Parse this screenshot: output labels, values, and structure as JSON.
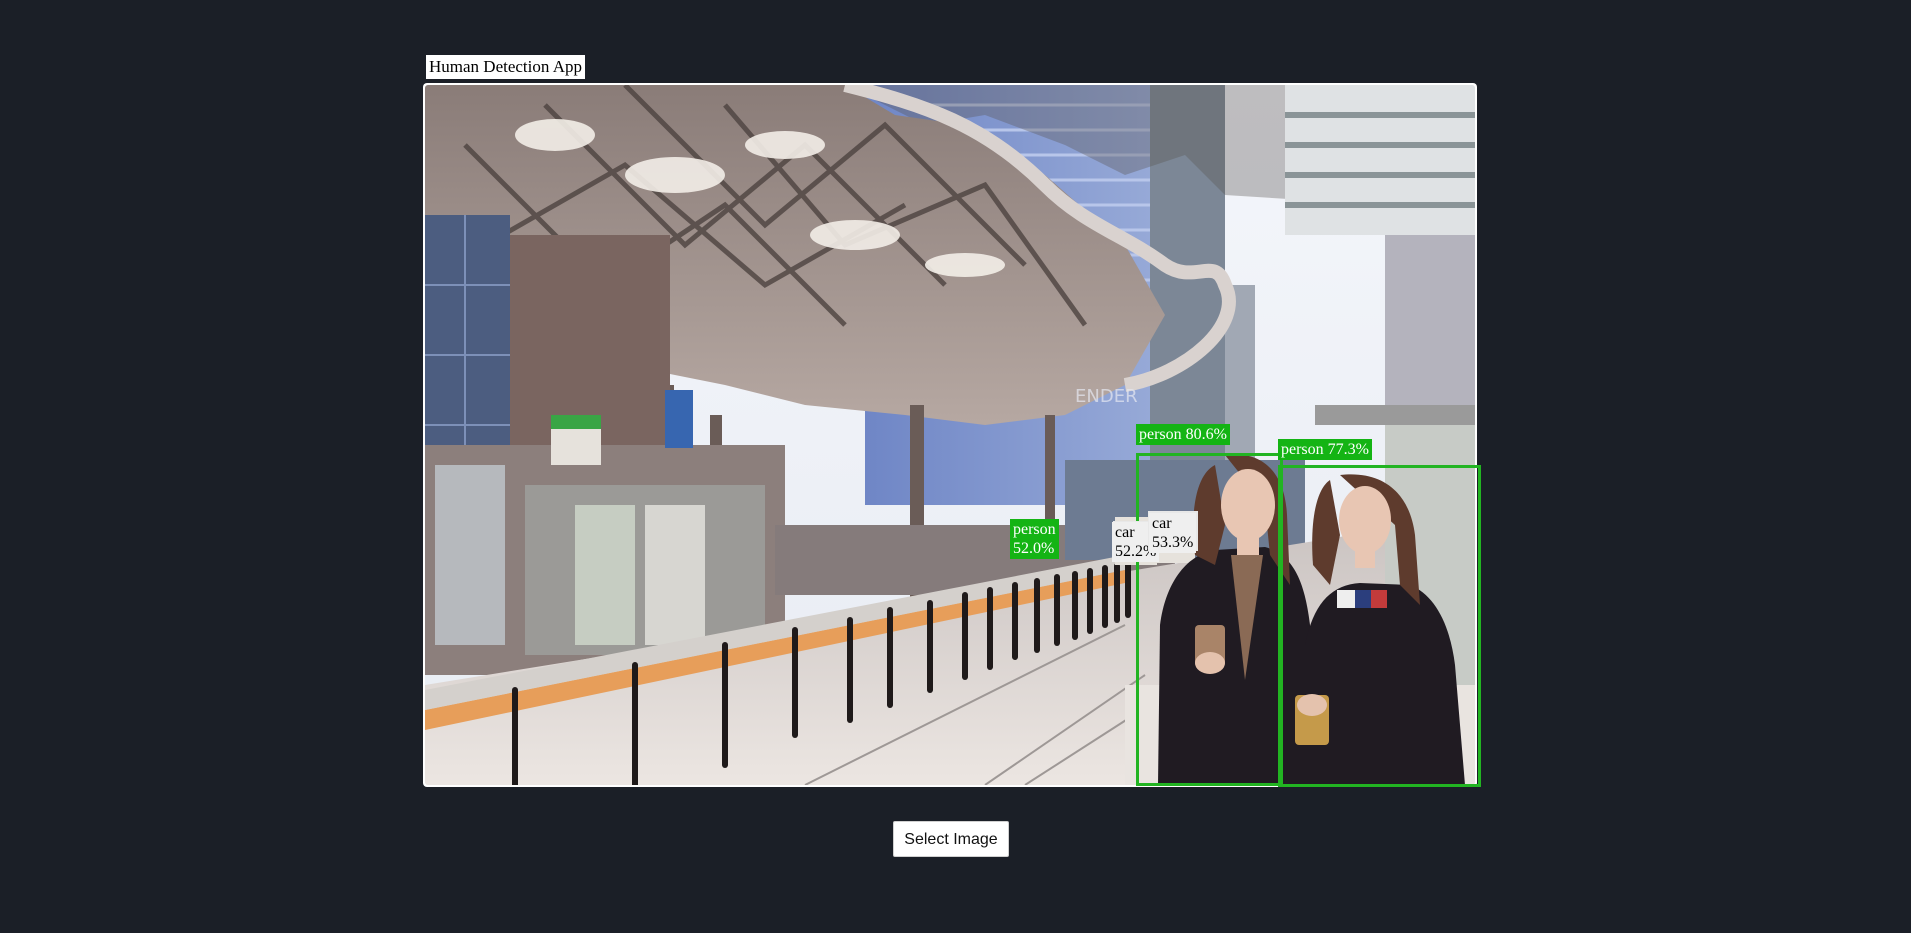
{
  "app": {
    "title": "Human Detection App"
  },
  "image": {
    "subject": "street-scene-photo"
  },
  "detections": [
    {
      "label": "person 80.6%",
      "class": "person",
      "confidence": 80.6,
      "color": "#22b422"
    },
    {
      "label": "person 77.3%",
      "class": "person",
      "confidence": 77.3,
      "color": "#22b422"
    },
    {
      "label": "person\n52.0%",
      "class": "person",
      "confidence": 52.0,
      "color": "#22b422"
    },
    {
      "label": "car\n52.2%",
      "class": "car",
      "confidence": 52.2,
      "color": "#e8e8e8"
    },
    {
      "label": "car\n53.3%",
      "class": "car",
      "confidence": 53.3,
      "color": "#e8e8e8"
    }
  ],
  "controls": {
    "select_image_label": "Select Image"
  },
  "colors": {
    "page_background": "#1b1f27",
    "person_box": "#22b422",
    "car_box": "#e8e8e8"
  }
}
